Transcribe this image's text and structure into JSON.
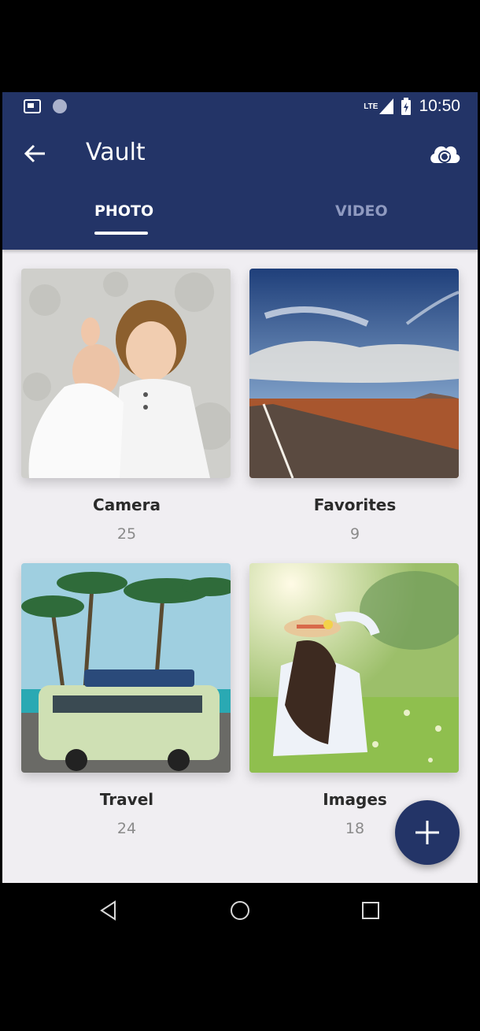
{
  "status_bar": {
    "time": "10:50",
    "network": "LTE"
  },
  "app": {
    "title": "Vault"
  },
  "tabs": [
    {
      "label": "PHOTO",
      "selected": true
    },
    {
      "label": "VIDEO",
      "selected": false
    }
  ],
  "albums": [
    {
      "name": "Camera",
      "count": "25"
    },
    {
      "name": "Favorites",
      "count": "9"
    },
    {
      "name": "Travel",
      "count": "24"
    },
    {
      "name": "Images",
      "count": "18"
    }
  ],
  "colors": {
    "primary": "#233467",
    "background": "#f0eef2",
    "tab_inactive": "#8f9ac0"
  },
  "icons": {
    "back": "arrow-left-icon",
    "cloud": "cloud-sync-icon",
    "fab": "plus-icon"
  }
}
